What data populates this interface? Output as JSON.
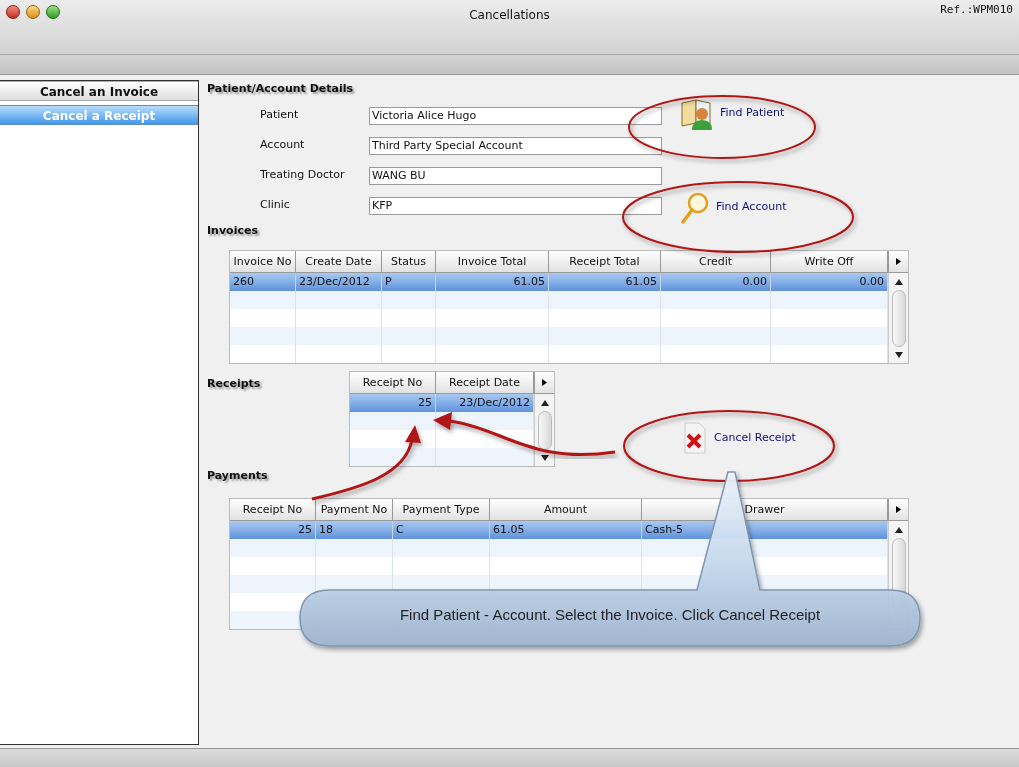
{
  "window": {
    "title": "Cancellations",
    "ref": "Ref.:WPM010"
  },
  "sidebar": {
    "items": [
      {
        "label": "Cancel an Invoice",
        "selected": false
      },
      {
        "label": "Cancel a Receipt",
        "selected": true
      }
    ]
  },
  "details": {
    "heading": "Patient/Account Details",
    "fields": [
      {
        "label": "Patient",
        "value": "Victoria Alice Hugo"
      },
      {
        "label": "Account",
        "value": "Third Party Special Account"
      },
      {
        "label": "Treating Doctor",
        "value": "WANG BU"
      },
      {
        "label": "Clinic",
        "value": "KFP"
      }
    ],
    "actions": [
      {
        "kind": "patient",
        "label": "Find Patient"
      },
      {
        "kind": "search",
        "label": "Find Account"
      }
    ]
  },
  "invoices": {
    "heading": "Invoices",
    "columns": [
      "Invoice No",
      "Create Date",
      "Status",
      "Invoice Total",
      "Receipt Total",
      "Credit",
      "Write Off"
    ],
    "rows": [
      {
        "selected": true,
        "cells": [
          "260",
          "23/Dec/2012",
          "P",
          "61.05",
          "61.05",
          "0.00",
          "0.00"
        ]
      }
    ]
  },
  "receipts": {
    "heading": "Receipts",
    "columns": [
      "Receipt No",
      "Receipt Date"
    ],
    "rows": [
      {
        "selected": true,
        "cells": [
          "25",
          "23/Dec/2012"
        ]
      }
    ],
    "action": {
      "kind": "cancel",
      "label": "Cancel Receipt"
    }
  },
  "payments": {
    "heading": "Payments",
    "columns": [
      "Receipt No",
      "Payment No",
      "Payment Type",
      "Amount",
      "Drawer"
    ],
    "rows": [
      {
        "selected": true,
        "cells": [
          "25",
          "18",
          "C",
          "61.05",
          "Cash-5"
        ]
      }
    ]
  },
  "callout": {
    "text": "Find Patient - Account. Select the Invoice. Click Cancel Receipt"
  }
}
